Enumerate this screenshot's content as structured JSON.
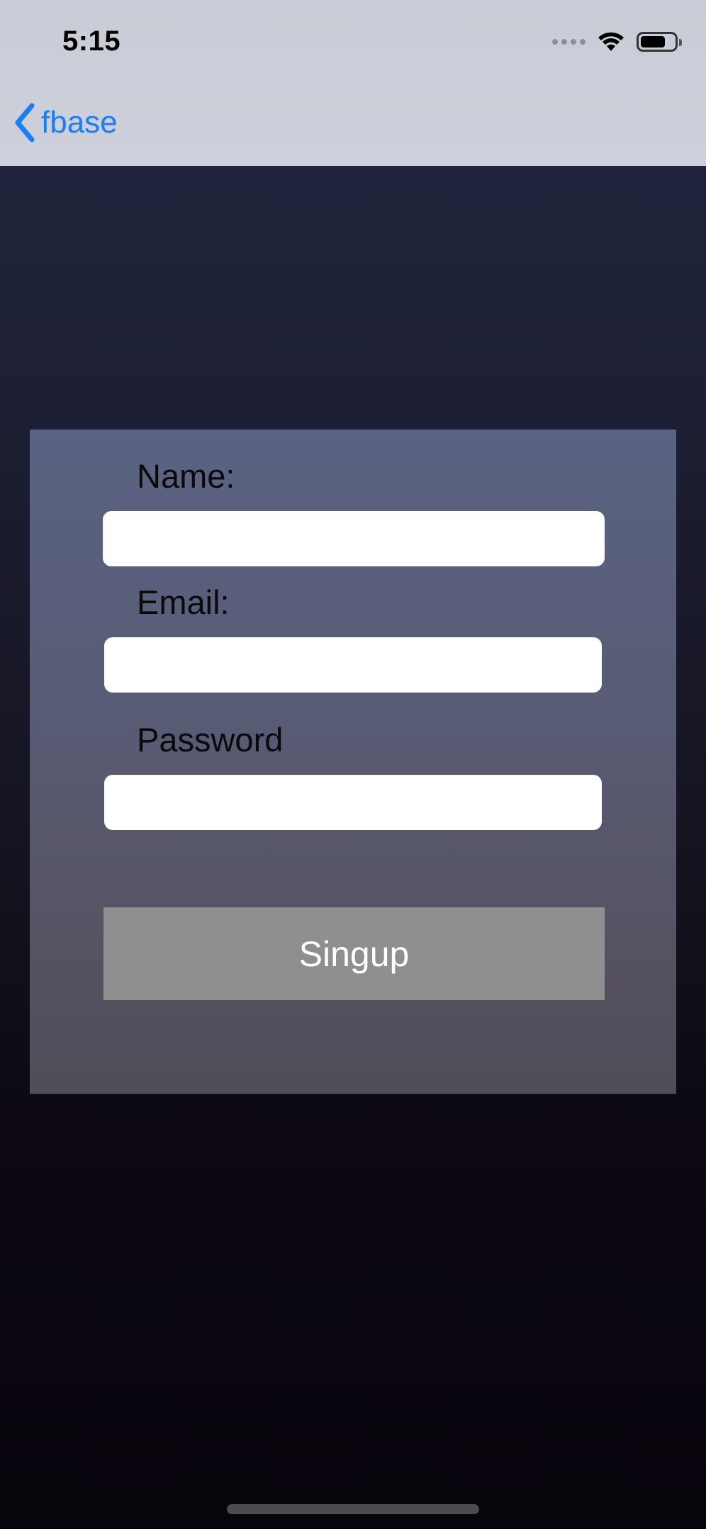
{
  "status_bar": {
    "time": "5:15"
  },
  "nav": {
    "back_label": "fbase"
  },
  "form": {
    "name_label": "Name:",
    "name_value": "",
    "email_label": "Email:",
    "email_value": "",
    "password_label": "Password",
    "password_value": "",
    "submit_label": "Singup"
  },
  "colors": {
    "accent": "#1a7ef5",
    "button_bg": "#8f8f8f",
    "card_bg": "#585b74",
    "background": "#15131f"
  }
}
